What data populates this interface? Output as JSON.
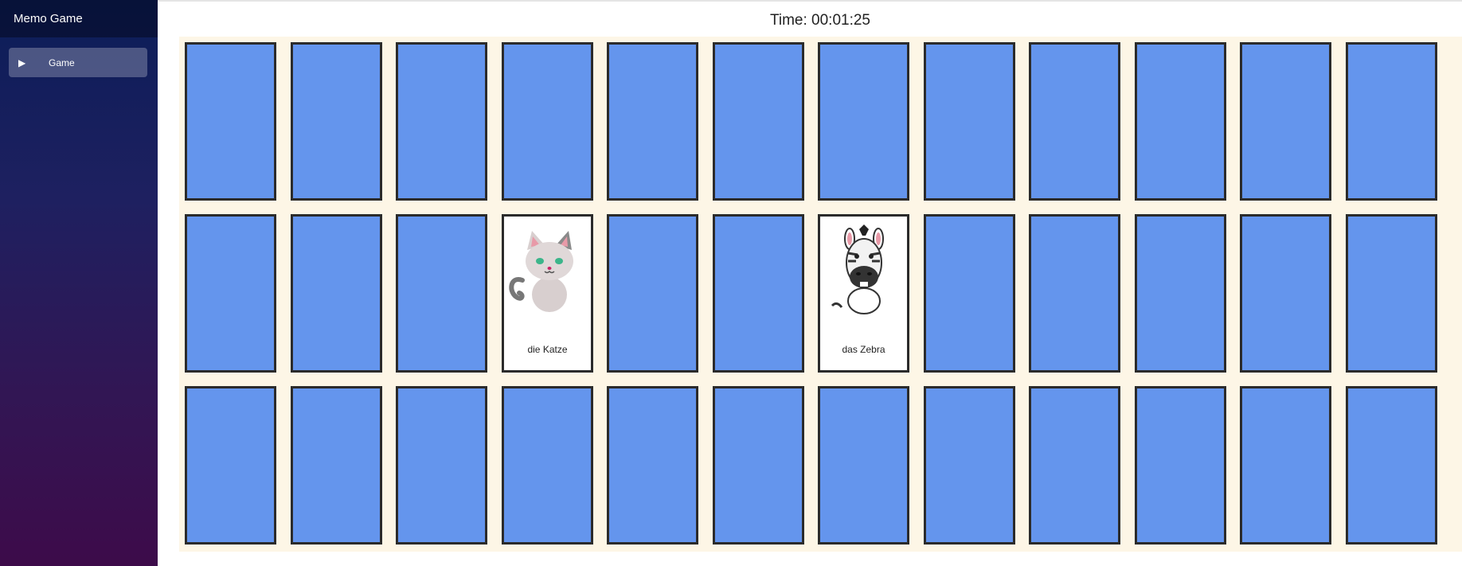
{
  "sidebar": {
    "title": "Memo Game",
    "nav": [
      {
        "label": "Game",
        "icon": "play-icon"
      }
    ]
  },
  "game": {
    "timer": "Time: 00:01:25",
    "columns": 12,
    "rows": 3,
    "cards": [
      {
        "state": "down"
      },
      {
        "state": "down"
      },
      {
        "state": "down"
      },
      {
        "state": "down"
      },
      {
        "state": "down"
      },
      {
        "state": "down"
      },
      {
        "state": "down"
      },
      {
        "state": "down"
      },
      {
        "state": "down"
      },
      {
        "state": "down"
      },
      {
        "state": "down"
      },
      {
        "state": "down"
      },
      {
        "state": "down"
      },
      {
        "state": "down"
      },
      {
        "state": "down"
      },
      {
        "state": "up",
        "label": "die Katze",
        "image": "cat-icon"
      },
      {
        "state": "down"
      },
      {
        "state": "down"
      },
      {
        "state": "up",
        "label": "das Zebra",
        "image": "zebra-icon"
      },
      {
        "state": "down"
      },
      {
        "state": "down"
      },
      {
        "state": "down"
      },
      {
        "state": "down"
      },
      {
        "state": "down"
      },
      {
        "state": "down"
      },
      {
        "state": "down"
      },
      {
        "state": "down"
      },
      {
        "state": "down"
      },
      {
        "state": "down"
      },
      {
        "state": "down"
      },
      {
        "state": "down"
      },
      {
        "state": "down"
      },
      {
        "state": "down"
      },
      {
        "state": "down"
      },
      {
        "state": "down"
      },
      {
        "state": "down"
      }
    ]
  },
  "colors": {
    "card_back": "#6495ed",
    "board": "#fdf6e6",
    "card_border": "#2b2b2b"
  }
}
